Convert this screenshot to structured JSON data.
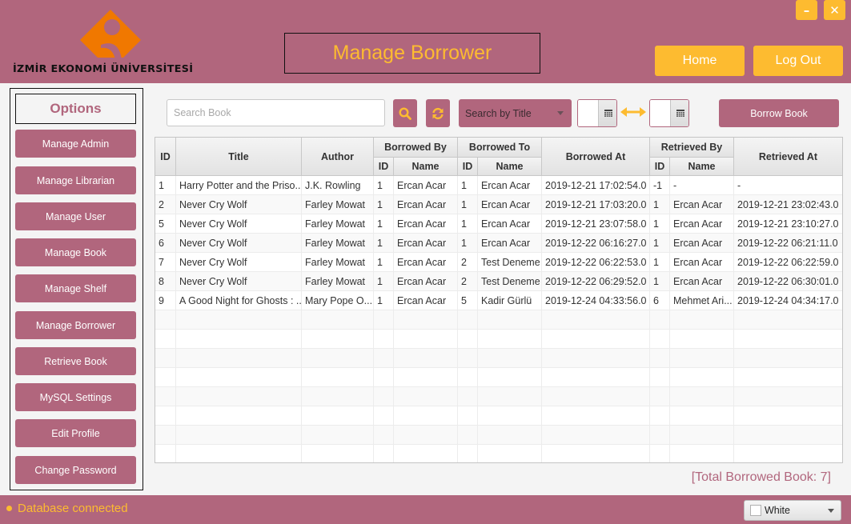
{
  "window": {
    "minimize_label": "–",
    "close_label": "✕",
    "accent": "#fdbb30",
    "primary": "#b1667d"
  },
  "header": {
    "logo_text": "İZMİR EKONOMİ ÜNİVERSİTESİ",
    "title": "Manage Borrower",
    "home_label": "Home",
    "logout_label": "Log Out"
  },
  "sidebar": {
    "title": "Options",
    "items": [
      {
        "label": "Manage Admin"
      },
      {
        "label": "Manage Librarian"
      },
      {
        "label": "Manage User"
      },
      {
        "label": "Manage Book"
      },
      {
        "label": "Manage Shelf"
      },
      {
        "label": "Manage Borrower"
      },
      {
        "label": "Retrieve Book"
      },
      {
        "label": "MySQL Settings"
      },
      {
        "label": "Edit Profile"
      },
      {
        "label": "Change Password"
      }
    ]
  },
  "toolbar": {
    "search_placeholder": "Search Book",
    "search_value": "",
    "search_icon": "search-icon",
    "refresh_icon": "refresh-icon",
    "search_by_selected": "Search by Title",
    "date_from": "",
    "date_to": "",
    "borrow_button": "Borrow Book"
  },
  "table": {
    "headers": {
      "id": "ID",
      "title": "Title",
      "author": "Author",
      "borrowed_by": "Borrowed By",
      "borrowed_to": "Borrowed To",
      "borrowed_at": "Borrowed At",
      "retrieved_by": "Retrieved By",
      "retrieved_at": "Retrieved At",
      "sub_id": "ID",
      "sub_name": "Name"
    },
    "rows": [
      [
        "1",
        "Harry Potter and the Priso...",
        "J.K. Rowling",
        "1",
        "Ercan Acar",
        "1",
        "Ercan Acar",
        "2019-12-21 17:02:54.0",
        "-1",
        "-",
        "-"
      ],
      [
        "2",
        "Never Cry Wolf",
        "Farley Mowat",
        "1",
        "Ercan Acar",
        "1",
        "Ercan Acar",
        "2019-12-21 17:03:20.0",
        "1",
        "Ercan Acar",
        "2019-12-21 23:02:43.0"
      ],
      [
        "5",
        "Never Cry Wolf",
        "Farley Mowat",
        "1",
        "Ercan Acar",
        "1",
        "Ercan Acar",
        "2019-12-21 23:07:58.0",
        "1",
        "Ercan Acar",
        "2019-12-21 23:10:27.0"
      ],
      [
        "6",
        "Never Cry Wolf",
        "Farley Mowat",
        "1",
        "Ercan Acar",
        "1",
        "Ercan Acar",
        "2019-12-22 06:16:27.0",
        "1",
        "Ercan Acar",
        "2019-12-22 06:21:11.0"
      ],
      [
        "7",
        "Never Cry Wolf",
        "Farley Mowat",
        "1",
        "Ercan Acar",
        "2",
        "Test Deneme",
        "2019-12-22 06:22:53.0",
        "1",
        "Ercan Acar",
        "2019-12-22 06:22:59.0"
      ],
      [
        "8",
        "Never Cry Wolf",
        "Farley Mowat",
        "1",
        "Ercan Acar",
        "2",
        "Test Deneme",
        "2019-12-22 06:29:52.0",
        "1",
        "Ercan Acar",
        "2019-12-22 06:30:01.0"
      ],
      [
        "9",
        "A Good Night for Ghosts : ...",
        "Mary Pope O...",
        "1",
        "Ercan Acar",
        "5",
        "Kadir Gürlü",
        "2019-12-24 04:33:56.0",
        "6",
        "Mehmet Ari...",
        "2019-12-24 04:34:17.0"
      ]
    ],
    "empty_rows": 8
  },
  "footer": {
    "total_text": "[Total Borrowed Book: 7]",
    "status_text": "Database connected",
    "theme_selected": "White"
  }
}
